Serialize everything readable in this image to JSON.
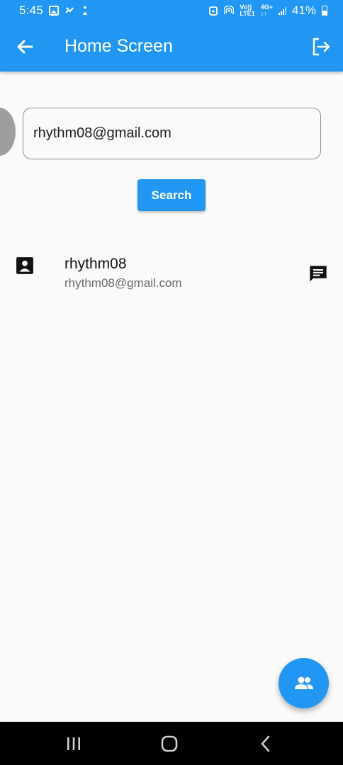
{
  "status_bar": {
    "time": "5:45",
    "network_top": "Vo))",
    "network_bottom": "LTE1",
    "network2_top": "4G+",
    "network2_bottom": "↓↑",
    "battery": "41%"
  },
  "app_bar": {
    "title": "Home Screen",
    "back_icon": "arrow-back-icon",
    "logout_icon": "logout-icon"
  },
  "search": {
    "value": "rhythm08@gmail.com",
    "button_label": "Search"
  },
  "results": [
    {
      "name": "rhythm08",
      "email": "rhythm08@gmail.com"
    }
  ],
  "fab": {
    "icon": "group-icon"
  },
  "colors": {
    "primary": "#2196f3",
    "background": "#fafafa",
    "nav_bar": "#000000"
  }
}
